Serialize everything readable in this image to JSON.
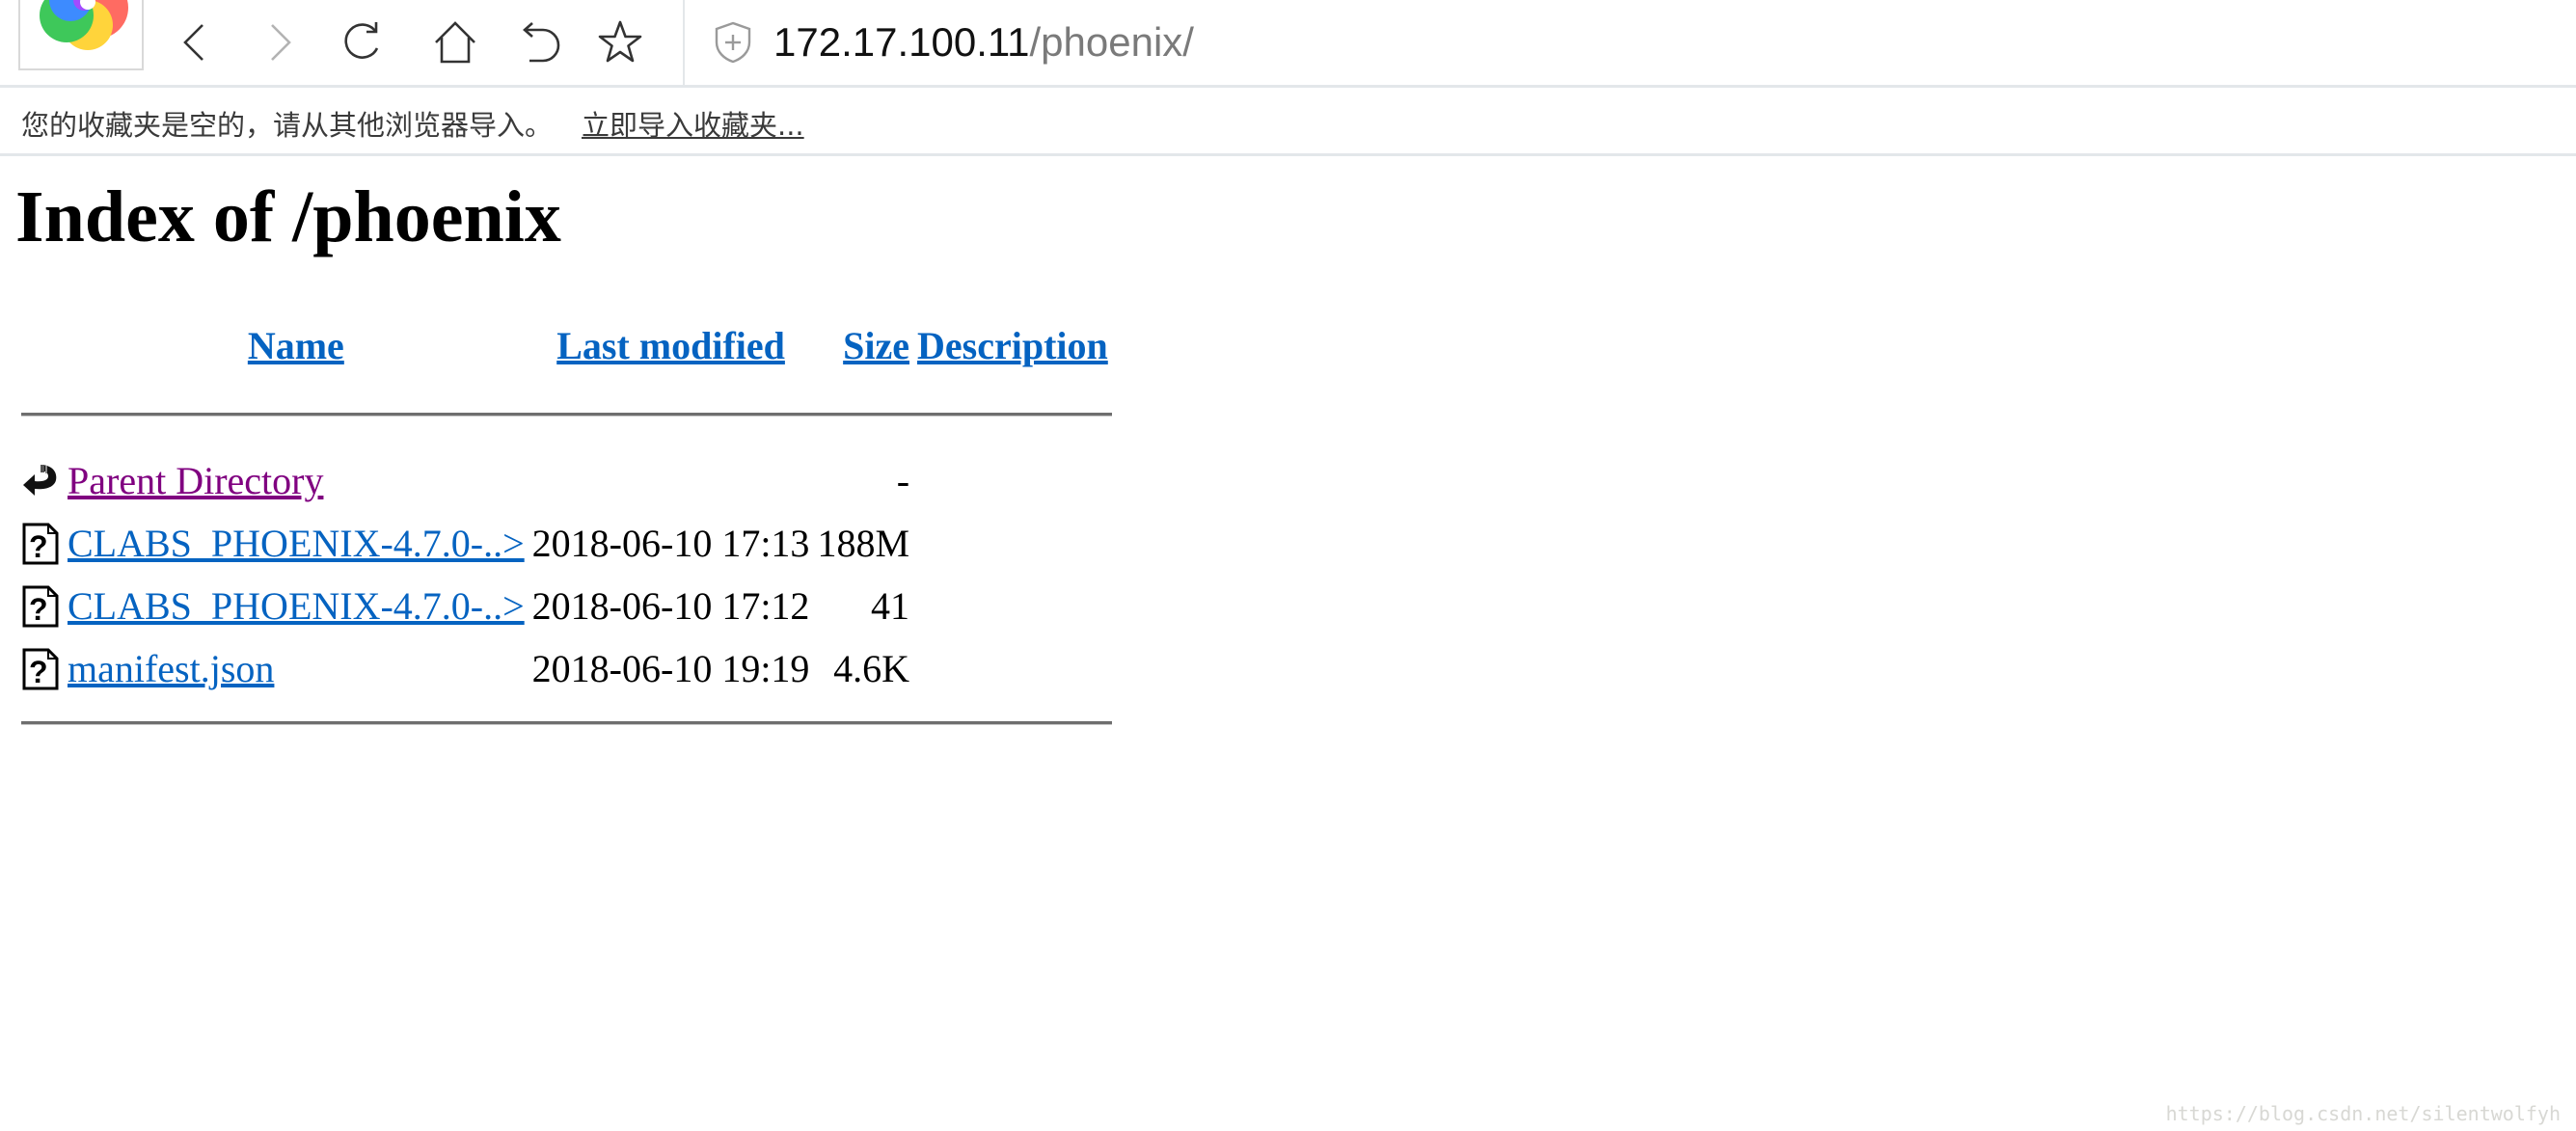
{
  "browser": {
    "toolbar": {
      "icons": [
        "browser-logo",
        "back-icon",
        "forward-icon",
        "reload-icon",
        "home-icon",
        "undo-icon",
        "star-icon"
      ]
    },
    "address_bar": {
      "security_icon": "shield-icon",
      "url_host": "172.17.100.11",
      "url_path": "/phoenix/"
    },
    "bookmarks_bar": {
      "message": "您的收藏夹是空的，请从其他浏览器导入。",
      "import_link": "立即导入收藏夹..."
    }
  },
  "page": {
    "title": "Index of /phoenix",
    "table": {
      "headers": {
        "name": "Name",
        "last_modified": "Last modified",
        "size": "Size",
        "description": "Description"
      },
      "rows": [
        {
          "icon": "parent-directory-icon",
          "name": "Parent Directory",
          "last_modified": "",
          "size": "-",
          "description": "",
          "visited": true
        },
        {
          "icon": "unknown-file-icon",
          "name": "CLABS_PHOENIX-4.7.0-..>",
          "last_modified": "2018-06-10 17:13",
          "size": "188M",
          "description": ""
        },
        {
          "icon": "unknown-file-icon",
          "name": "CLABS_PHOENIX-4.7.0-..>",
          "last_modified": "2018-06-10 17:12",
          "size": "41",
          "description": ""
        },
        {
          "icon": "unknown-file-icon",
          "name": "manifest.json",
          "last_modified": "2018-06-10 19:19",
          "size": "4.6K",
          "description": ""
        }
      ]
    }
  },
  "watermark": "https://blog.csdn.net/silentwolfyh",
  "colors": {
    "link": "#0563c1",
    "visited_link": "#800080",
    "separator": "#e3e7ea"
  }
}
